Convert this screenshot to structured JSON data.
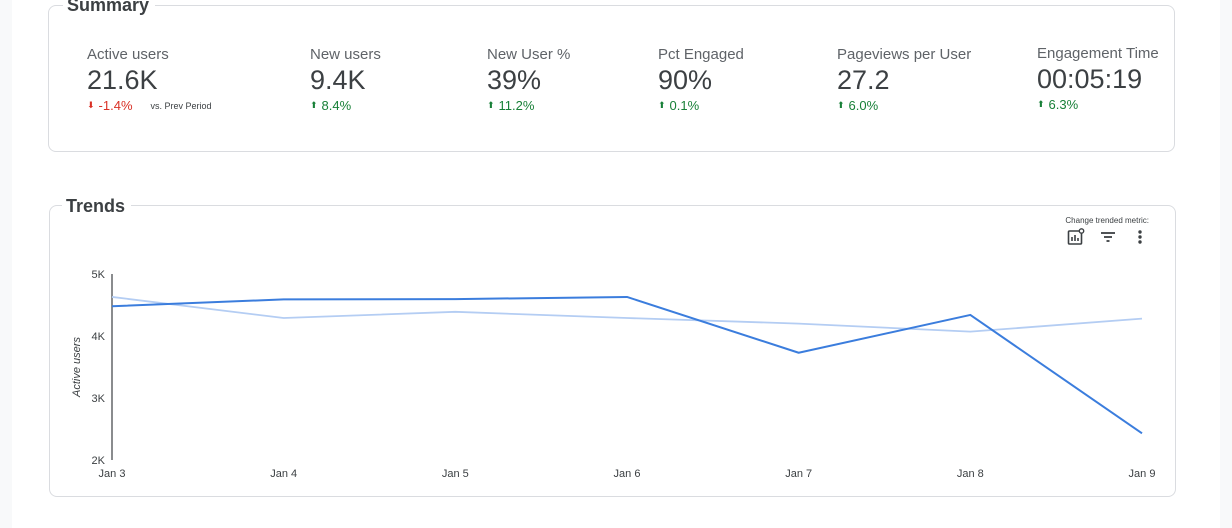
{
  "summary": {
    "title": "Summary",
    "vs_label": "vs. Prev Period",
    "metrics": [
      {
        "label": "Active users",
        "value": "21.6K",
        "change": "-1.4%",
        "direction": "down"
      },
      {
        "label": "New users",
        "value": "9.4K",
        "change": "8.4%",
        "direction": "up"
      },
      {
        "label": "New User %",
        "value": "39%",
        "change": "11.2%",
        "direction": "up"
      },
      {
        "label": "Pct Engaged",
        "value": "90%",
        "change": "0.1%",
        "direction": "up"
      },
      {
        "label": "Pageviews per User",
        "value": "27.2",
        "change": "6.0%",
        "direction": "up"
      },
      {
        "label": "Engagement Time",
        "value": "00:05:19",
        "change": "6.3%",
        "direction": "up"
      }
    ]
  },
  "trends": {
    "title": "Trends",
    "change_metric_label": "Change trended metric:",
    "icons": [
      "chart-settings-icon",
      "filter-icon",
      "more-vert-icon"
    ]
  },
  "colors": {
    "up": "#188038",
    "down": "#d93025",
    "series_current": "#3b7ddd",
    "series_previous": "#b4cdf3"
  },
  "chart_data": {
    "type": "line",
    "categories": [
      "Jan 3",
      "Jan 4",
      "Jan 5",
      "Jan 6",
      "Jan 7",
      "Jan 8",
      "Jan 9"
    ],
    "series": [
      {
        "values": [
          4480,
          4590,
          4595,
          4630,
          3730,
          4340,
          2430
        ]
      },
      {
        "values": [
          4630,
          4290,
          4390,
          4290,
          4200,
          4070,
          4280
        ]
      }
    ],
    "ylabel": "Active users",
    "yticks": [
      "2K",
      "3K",
      "4K",
      "5K"
    ],
    "ylim": [
      2000,
      5000
    ],
    "grid": false,
    "legend": "none"
  }
}
